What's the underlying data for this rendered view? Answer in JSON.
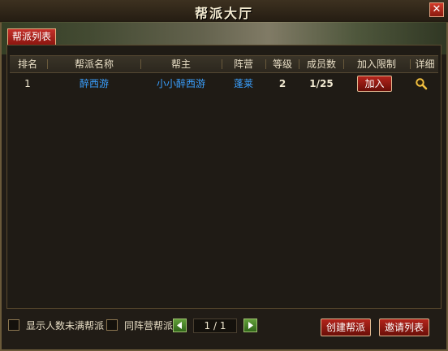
{
  "window": {
    "title": "帮派大厅",
    "close_label": "✕"
  },
  "tabs": [
    {
      "label": "帮派列表"
    }
  ],
  "table": {
    "headers": [
      "排名",
      "帮派名称",
      "帮主",
      "阵营",
      "等级",
      "成员数",
      "加入限制",
      "详细"
    ],
    "rows": [
      {
        "rank": "1",
        "name": "醉西游",
        "leader": "小小醉西游",
        "camp": "蓬莱",
        "level": "2",
        "members": "1/25",
        "join_label": "加入",
        "detail_icon": "magnifier-icon"
      }
    ]
  },
  "filters": {
    "not_full_label": "显示人数未满帮派",
    "same_camp_label": "同阵营帮派"
  },
  "pagination": {
    "current": "1 / 1"
  },
  "buttons": {
    "create_label": "创建帮派",
    "invite_label": "邀请列表"
  },
  "colors": {
    "accent_red": "#b4241c",
    "link_blue": "#3aa0ff",
    "page_green": "#4a8a2a"
  }
}
